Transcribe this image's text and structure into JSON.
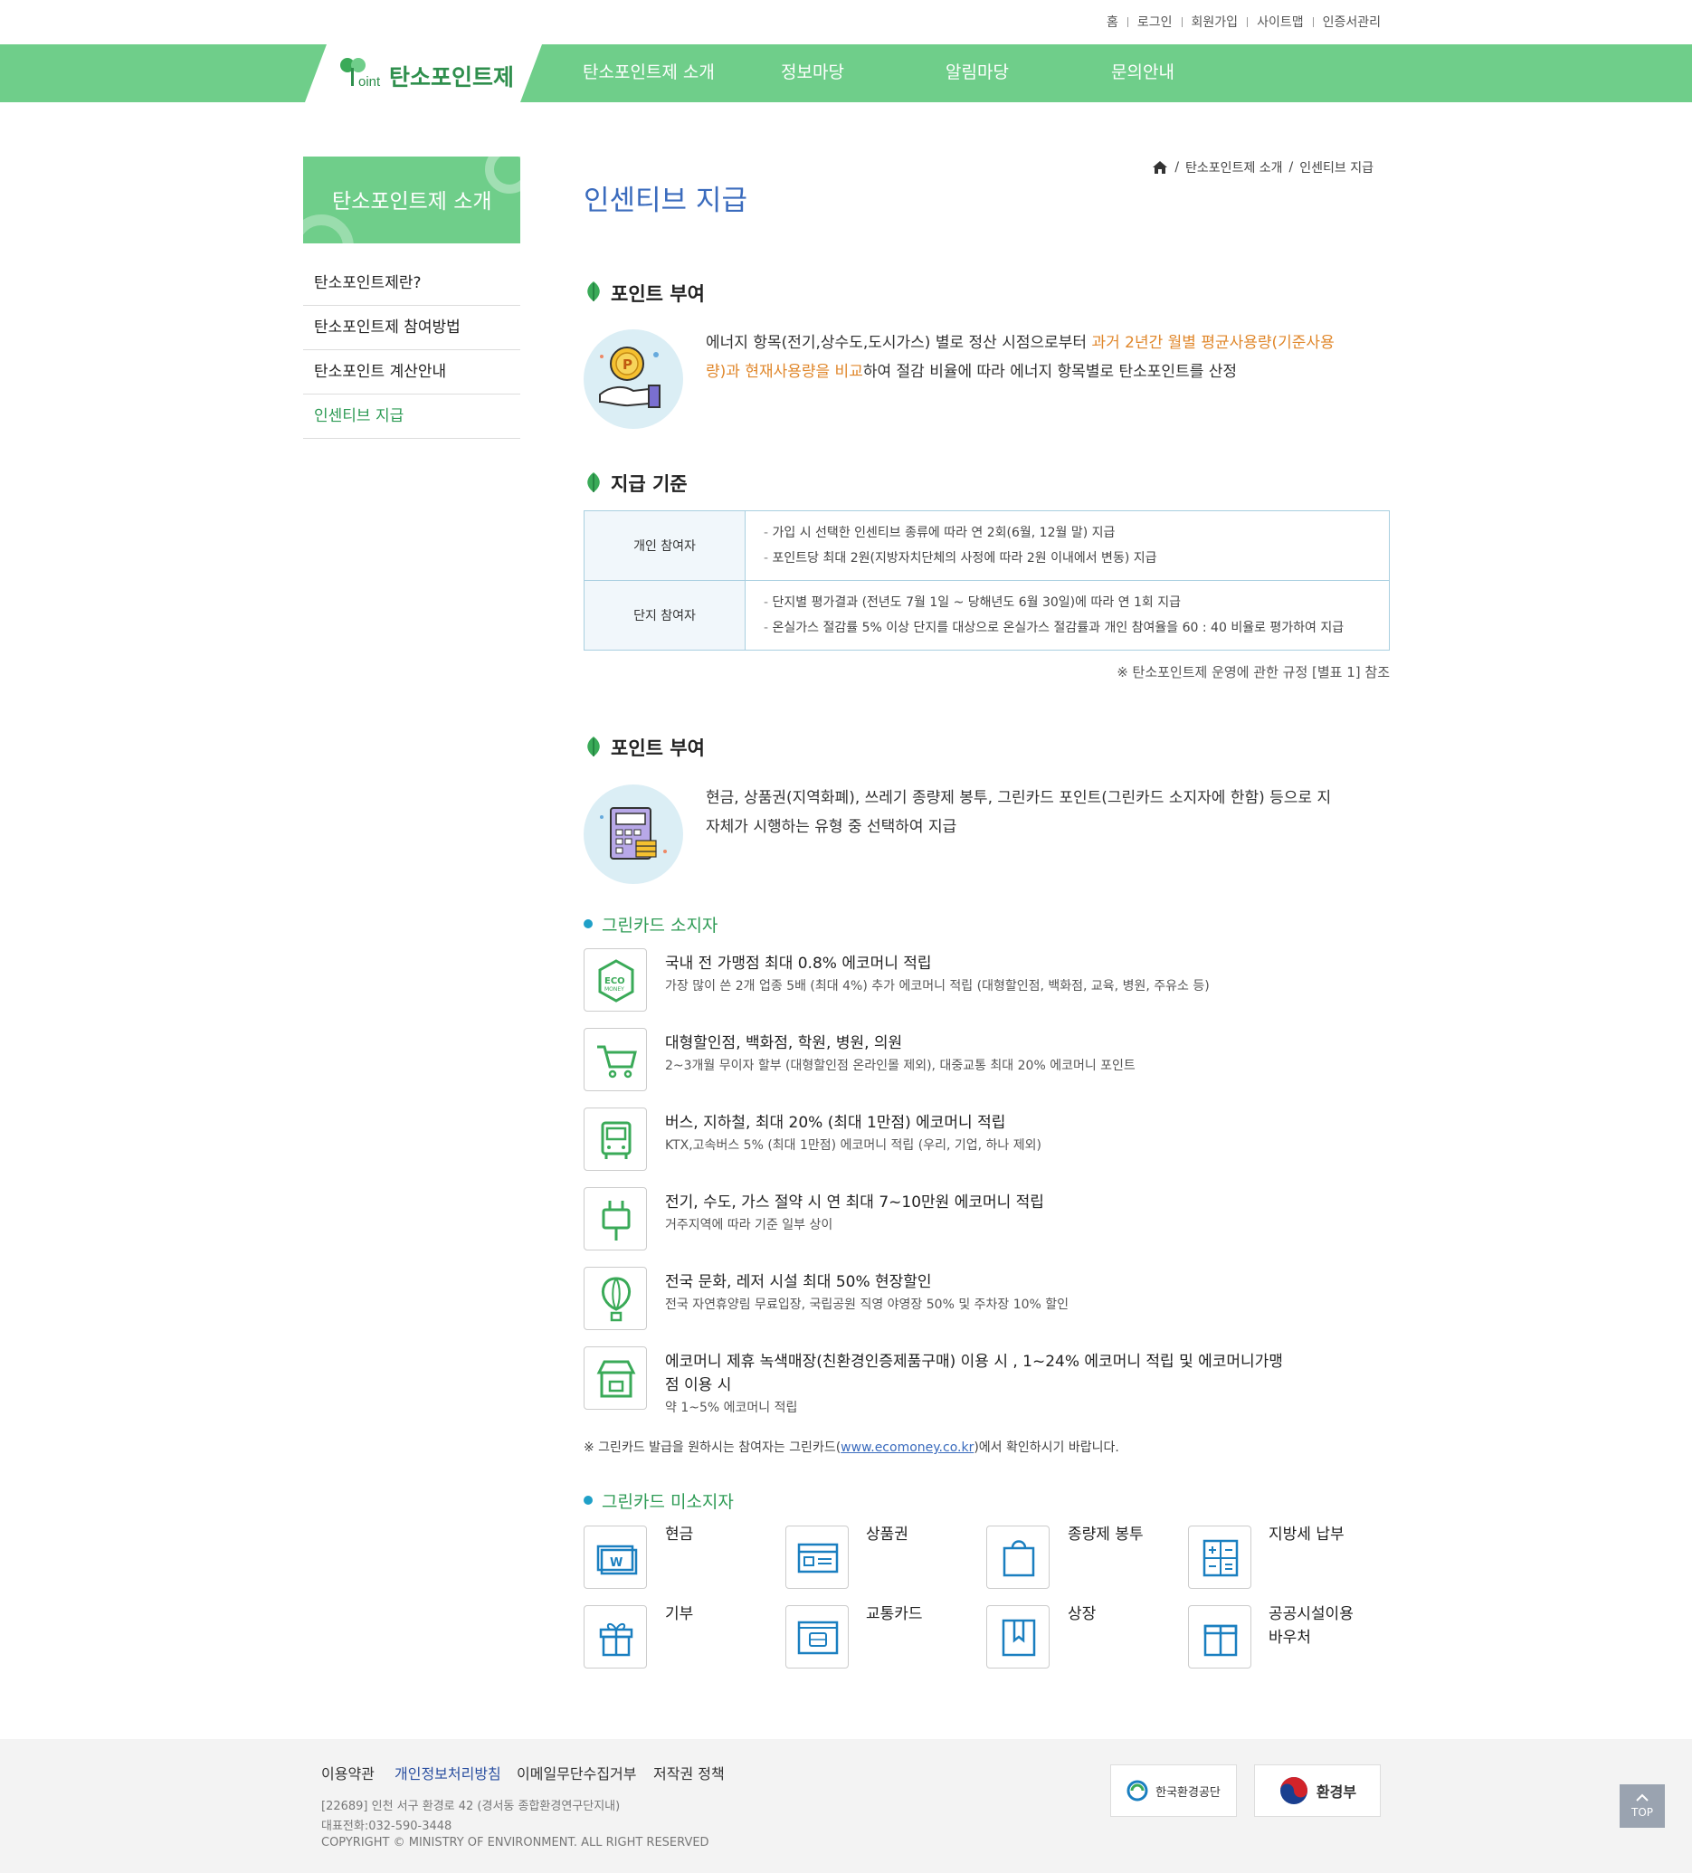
{
  "util_nav": [
    "홈",
    "로그인",
    "회원가입",
    "사이트맵",
    "인증서관리"
  ],
  "logo": {
    "text": "탄소포인트제",
    "mark": "oint"
  },
  "gnb": [
    "탄소포인트제 소개",
    "정보마당",
    "알림마당",
    "문의안내"
  ],
  "sidebar": {
    "title": "탄소포인트제 소개",
    "items": [
      "탄소포인트제란?",
      "탄소포인트제 참여방법",
      "탄소포인트 계산안내",
      "인센티브 지급"
    ],
    "active_index": 3
  },
  "breadcrumb": [
    "탄소포인트제 소개",
    "인센티브 지급"
  ],
  "page_title": "인센티브 지급",
  "section1": {
    "title": "포인트 부여",
    "text_pre": "에너지 항목(전기,상수도,도시가스) 별로 정산 시점으로부터 ",
    "text_hl": "과거 2년간 월별 평균사용량(기준사용량)과 현재사용량을 비교",
    "text_post": "하여 절감 비율에 따라 에너지 항목별로 탄소포인트를 산정"
  },
  "section2": {
    "title": "지급 기준",
    "rows": [
      {
        "header": "개인 참여자",
        "lines": [
          "가입 시 선택한 인센티브 종류에 따라 연 2회(6월, 12월 말) 지급",
          "포인트당 최대 2원(지방자치단체의 사정에 따라 2원 이내에서 변동) 지급"
        ]
      },
      {
        "header": "단지 참여자",
        "lines": [
          "단지별 평가결과 (전년도 7월 1일 ~ 당해년도 6월 30일)에 따라 연 1회 지급",
          "온실가스 절감률 5% 이상 단지를 대상으로 온실가스 절감률과 개인 참여율을 60 : 40 비율로 평가하여 지급"
        ]
      }
    ],
    "note": "※ 탄소포인트제 운영에 관한 규정 [별표 1] 참조"
  },
  "section3": {
    "title": "포인트 부여",
    "text": "현금, 상품권(지역화폐), 쓰레기 종량제 봉투, 그린카드 포인트(그린카드 소지자에 한함) 등으로 지자체가 시행하는 유형 중 선택하여 지급"
  },
  "greencard": {
    "title": "그린카드 소지자",
    "items": [
      {
        "icon": "eco-money-icon",
        "title": "국내 전 가맹점 최대 0.8% 에코머니 적립",
        "desc": "가장 많이 쓴 2개 업종 5배 (최대 4%) 추가 에코머니 적립 (대형할인점, 백화점, 교육, 병원, 주유소 등)"
      },
      {
        "icon": "cart-icon",
        "title": "대형할인점, 백화점, 학원, 병원, 의원",
        "desc": "2~3개월 무이자 할부 (대형할인점 온라인몰 제외), 대중교통 최대 20% 에코머니 포인트"
      },
      {
        "icon": "bus-icon",
        "title": "버스, 지하철, 최대 20% (최대 1만점) 에코머니 적립",
        "desc": "KTX,고속버스 5% (최대 1만점) 에코머니 적립 (우리, 기업, 하나 제외)"
      },
      {
        "icon": "plug-icon",
        "title": "전기, 수도, 가스 절약 시 연 최대 7~10만원 에코머니 적립",
        "desc": "거주지역에 따라 기준 일부 상이"
      },
      {
        "icon": "balloon-icon",
        "title": "전국 문화, 레저 시설 최대 50% 현장할인",
        "desc": "전국 자연휴양림 무료입장, 국립공원 직영 야영장 50% 및 주차장 10% 할인"
      },
      {
        "icon": "store-icon",
        "title_line1": "에코머니 제휴 녹색매장(친환경인증제품구매) 이용 시 , 1~24% 에코머니 적립 및 에코머니가맹",
        "title_line2": "점 이용 시",
        "desc": "약 1~5% 에코머니 적립"
      }
    ],
    "note_pre": "※ 그린카드 발급을 원하시는 참여자는 그린카드(",
    "note_link": "www.ecomoney.co.kr",
    "note_post": ")에서 확인하시기 바랍니다."
  },
  "non_greencard": {
    "title": "그린카드 미소지자",
    "items": [
      {
        "icon": "cash-icon",
        "label": "현금"
      },
      {
        "icon": "voucher-icon",
        "label": "상품권"
      },
      {
        "icon": "bag-icon",
        "label": "종량제 봉투"
      },
      {
        "icon": "calculator-icon",
        "label": "지방세 납부"
      },
      {
        "icon": "gift-icon",
        "label": "기부"
      },
      {
        "icon": "transit-card-icon",
        "label": "교통카드"
      },
      {
        "icon": "award-icon",
        "label": "상장"
      },
      {
        "icon": "facility-icon",
        "label_line1": "공공시설이용",
        "label_line2": "바우처"
      }
    ]
  },
  "footer": {
    "links": [
      "이용약관",
      "개인정보처리방침",
      "이메일무단수집거부",
      "저작권 정책"
    ],
    "address": "[22689] 인천 서구 환경로 42 (경서동 종합환경연구단지내)",
    "phone": "대표전화:032-590-3448",
    "copyright": "COPYRIGHT © MINISTRY OF ENVIRONMENT. ALL RIGHT RESERVED",
    "badges": [
      "한국환경공단",
      "환경부"
    ],
    "top_label": "TOP"
  },
  "colors": {
    "brand_green": "#6fce8a",
    "title_blue": "#3a6bbd",
    "highlight_orange": "#e0872b",
    "sub_green": "#2e9b55"
  }
}
